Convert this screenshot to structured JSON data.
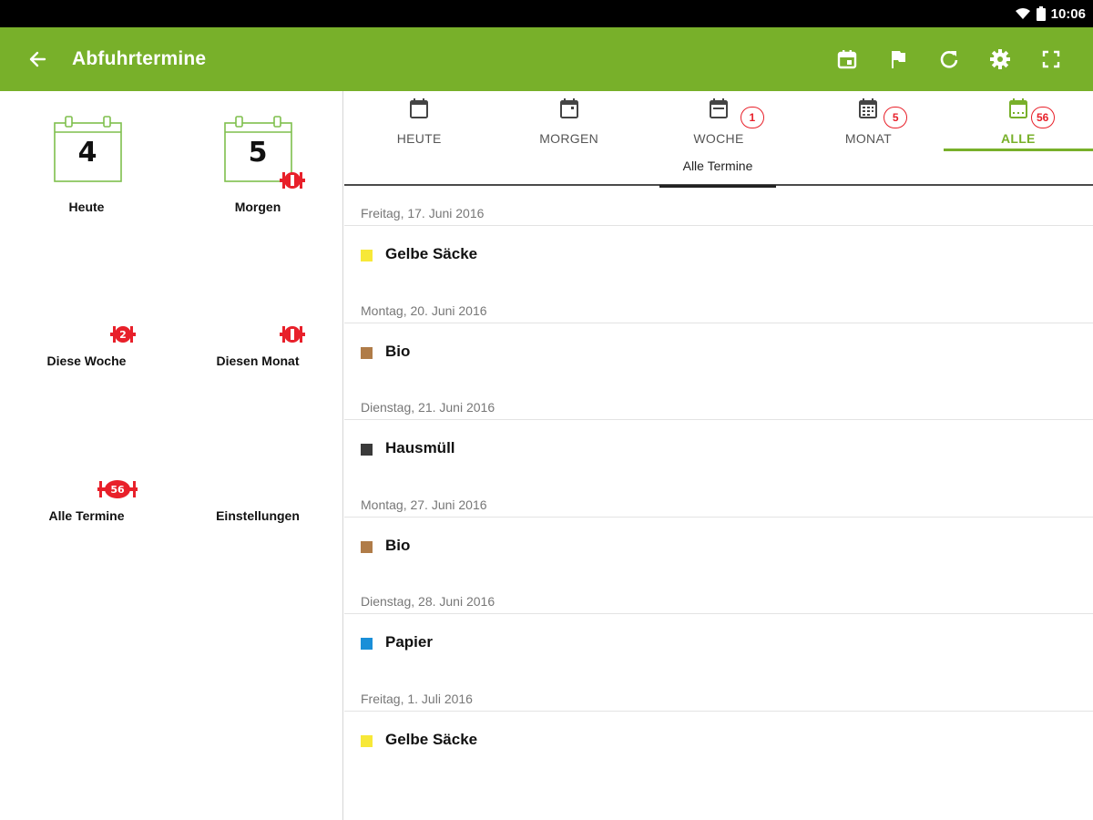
{
  "status": {
    "time": "10:06"
  },
  "appbar": {
    "title": "Abfuhrtermine",
    "actions": [
      {
        "icon": "calendar-event-icon"
      },
      {
        "icon": "flag-icon"
      },
      {
        "icon": "refresh-icon"
      },
      {
        "icon": "gear-icon"
      },
      {
        "icon": "fullscreen-icon"
      }
    ]
  },
  "sidebar": {
    "tiles": [
      {
        "label": "Heute",
        "day": "4"
      },
      {
        "label": "Morgen",
        "day": "5"
      },
      {
        "label": "Diese Woche"
      },
      {
        "label": "Diesen Monat"
      },
      {
        "label": "Alle Termine"
      },
      {
        "label": "Einstellungen"
      }
    ]
  },
  "tabs": [
    {
      "label": "HEUTE",
      "badge": ""
    },
    {
      "label": "MORGEN",
      "badge": ""
    },
    {
      "label": "WOCHE",
      "badge": "1"
    },
    {
      "label": "MONAT",
      "badge": "5"
    },
    {
      "label": "ALLE",
      "badge": "56"
    }
  ],
  "subtab": {
    "label": "Alle Termine"
  },
  "list": [
    {
      "date": "Freitag, 17. Juni 2016",
      "name": "Gelbe Säcke",
      "color": "#f7e838"
    },
    {
      "date": "Montag, 20. Juni 2016",
      "name": "Bio",
      "color": "#b07c48"
    },
    {
      "date": "Dienstag, 21. Juni 2016",
      "name": "Hausmüll",
      "color": "#3a3a3a"
    },
    {
      "date": "Montag, 27. Juni 2016",
      "name": "Bio",
      "color": "#b07c48"
    },
    {
      "date": "Dienstag, 28. Juni 2016",
      "name": "Papier",
      "color": "#1a8fd8"
    },
    {
      "date": "Freitag, 1. Juli 2016",
      "name": "Gelbe Säcke",
      "color": "#f7e838"
    }
  ],
  "colors": {
    "primary": "#78b02a",
    "badge": "#e8202a"
  }
}
